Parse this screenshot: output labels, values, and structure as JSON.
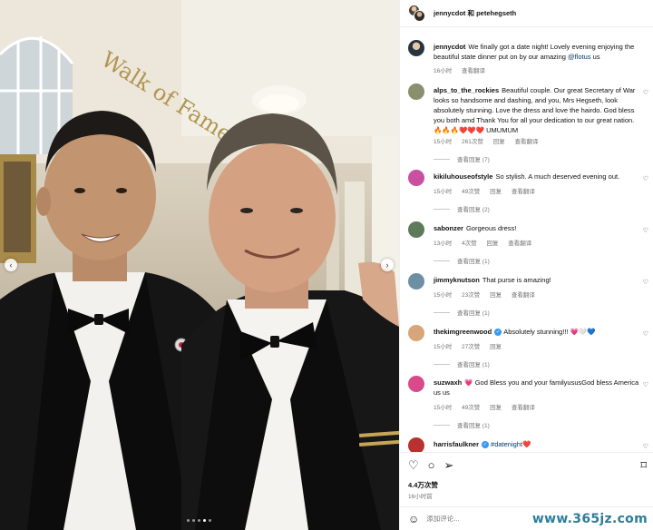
{
  "header": {
    "title": "jennycdot 和 petehegseth"
  },
  "photo": {
    "total_slides": 5,
    "active_slide": 4
  },
  "caption": {
    "user": "jennycdot",
    "text": "We finally got a date night! Lovely evening enjoying the beautiful state dinner put on by our amazing",
    "mention": "@flotus",
    "text_after": " us",
    "time": "16小时",
    "translate": "查看翻译"
  },
  "comments": [
    {
      "user": "alps_to_the_rockies",
      "text": "Beautiful couple. Our great Secretary of War looks so handsome and dashing, and you, Mrs Hegseth, look absolutely stunning. Love the dress and love the hairdo. God bless you both amd Thank You for all your dedication to our great nation. 🔥🔥🔥❤️❤️❤️ UMUMUM",
      "time": "15小时",
      "likes": "261次赞",
      "reply": "回复",
      "translate": "查看翻译",
      "replies": "查看回复 (7)",
      "avatar_color": "#8a8f6f"
    },
    {
      "user": "kikiluhouseofstyle",
      "text": "So stylish. A much deserved evening out.",
      "time": "15小时",
      "likes": "49次赞",
      "reply": "回复",
      "translate": "查看翻译",
      "replies": "查看回复 (2)",
      "avatar_color": "#c94fa0"
    },
    {
      "user": "sabonzer",
      "text": "Gorgeous dress!",
      "time": "13小时",
      "likes": "4次赞",
      "reply": "回复",
      "translate": "查看翻译",
      "replies": "查看回复 (1)",
      "avatar_color": "#5d7a5a"
    },
    {
      "user": "jimmyknutson",
      "text": "That purse is amazing!",
      "time": "15小时",
      "likes": "23次赞",
      "reply": "回复",
      "translate": "查看翻译",
      "replies": "查看回复 (1)",
      "avatar_color": "#6d8fa3"
    },
    {
      "user": "thekimgreenwood",
      "verified": true,
      "text": "Absolutely stunning!!! 💗🤍💙",
      "time": "15小时",
      "likes": "27次赞",
      "reply": "回复",
      "translate": "",
      "replies": "查看回复 (1)",
      "avatar_color": "#d8a57a"
    },
    {
      "user": "suzwaxh",
      "text": "💗 God Bless you and your familyususGod bless America us us",
      "time": "15小时",
      "likes": "49次赞",
      "reply": "回复",
      "translate": "查看翻译",
      "replies": "查看回复 (1)",
      "avatar_color": "#d84a8a"
    },
    {
      "user": "harrisfaulkner",
      "verified": true,
      "text": "#datenight❤️",
      "avatar_color": "#b8312f"
    }
  ],
  "actions": {
    "likes": "4.4万次赞",
    "time": "16小时前"
  },
  "add_comment": {
    "placeholder": "添加评论..."
  },
  "watermark": "www.365jz.com"
}
